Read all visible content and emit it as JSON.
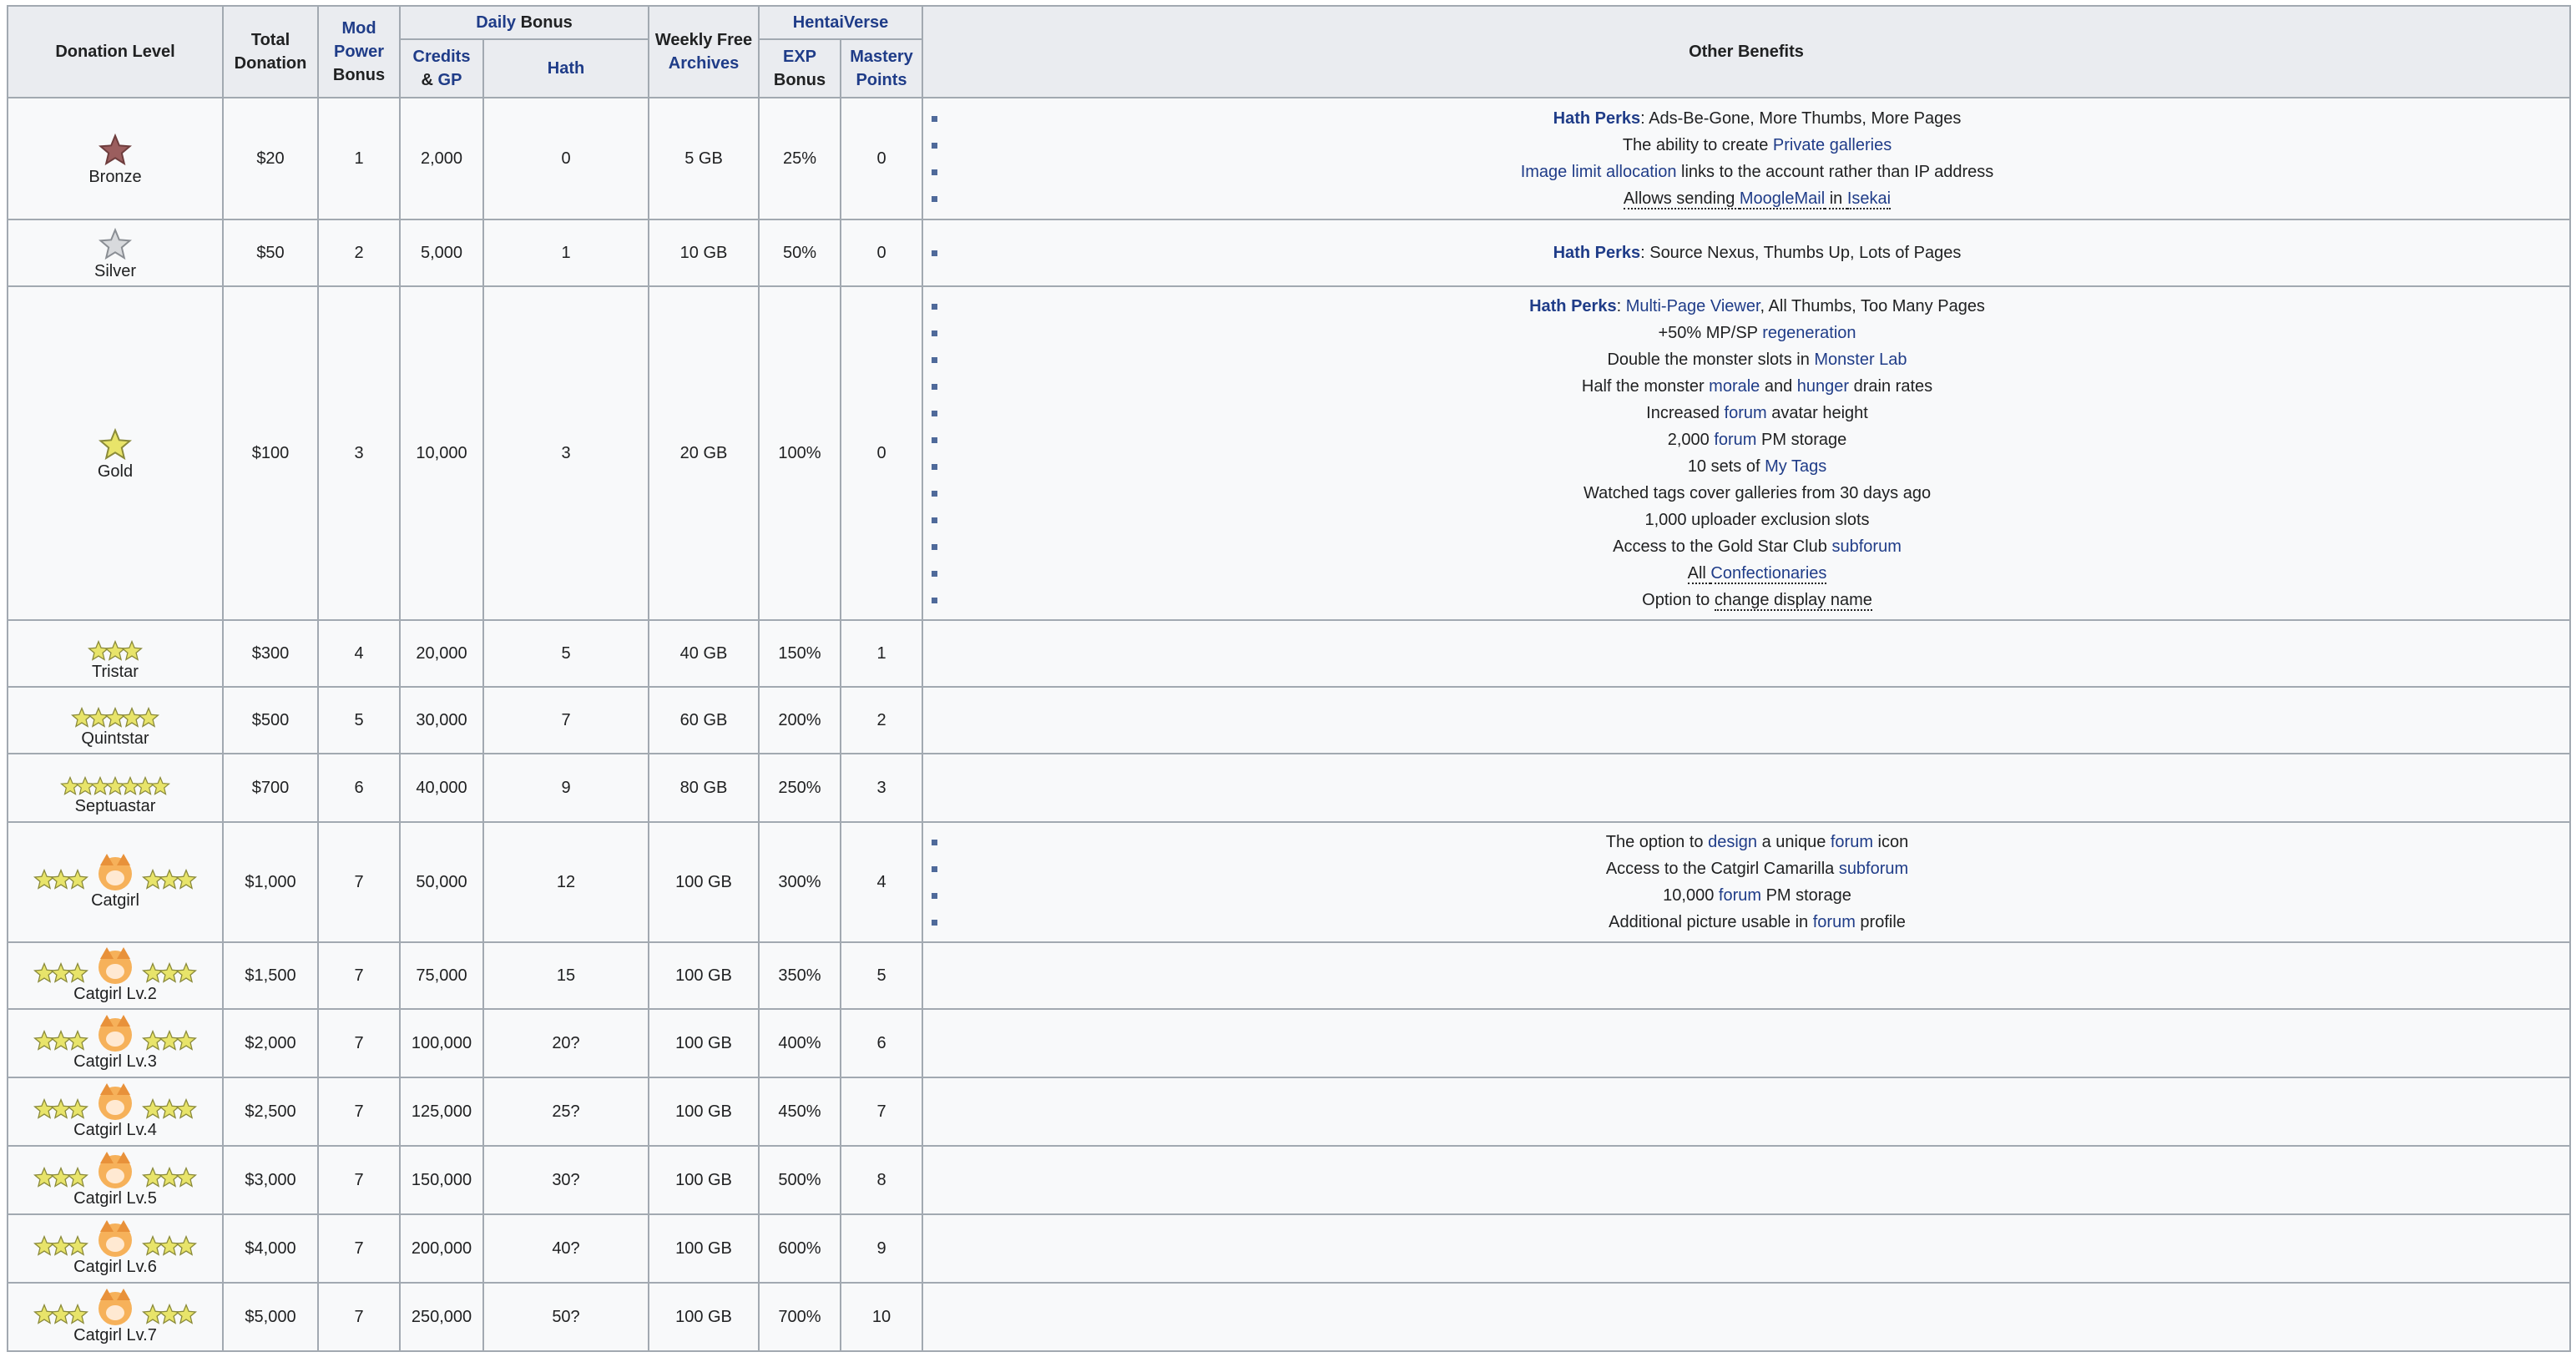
{
  "headers": {
    "donation_level": "Donation Level",
    "total_donation": "Total Donation",
    "mod_power_link": "Mod Power",
    "mod_power_suffix": "Bonus",
    "daily_bonus_link": "Daily",
    "daily_bonus_suffix": "Bonus",
    "weekly_free": "Weekly Free",
    "weekly_archives_link": "Archives",
    "hentaiverse": "HentaiVerse",
    "credits": "Credits",
    "gp_prefix": "&",
    "gp": "GP",
    "hath": "Hath",
    "exp_link": "EXP",
    "exp_suffix": "Bonus",
    "mastery_points": "Mastery Points",
    "other_benefits": "Other Benefits"
  },
  "colors": {
    "header_bg": "#eaecf0",
    "cell_bg": "#f8f9fa",
    "border": "#a2a9b1",
    "link": "#1f3c88",
    "bronze_star": "#9b5e5e",
    "silver_star": "#d8dadd",
    "gold_star": "#e8e46a"
  },
  "rows": [
    {
      "level": "Bronze",
      "icon": "bronze-star-icon",
      "total": "$20",
      "mod": "1",
      "credits": "2,000",
      "hath": "0",
      "archives": "5 GB",
      "exp": "25%",
      "mastery": "0",
      "benefits": [
        {
          "parts": [
            {
              "t": "Hath Perks",
              "link": true,
              "bold": true
            },
            {
              "t": ": Ads-Be-Gone, More Thumbs, More Pages"
            }
          ]
        },
        {
          "parts": [
            {
              "t": "The ability to create "
            },
            {
              "t": "Private galleries",
              "link": true
            }
          ]
        },
        {
          "parts": [
            {
              "t": "Image limit allocation",
              "link": true
            },
            {
              "t": " links to the account rather than IP address"
            }
          ]
        },
        {
          "parts": [
            {
              "t": "Allows sending ",
              "dotted": true
            },
            {
              "t": "MoogleMail",
              "link": true,
              "dotted": true
            },
            {
              "t": " in ",
              "dotted": true
            },
            {
              "t": "Isekai",
              "link": true,
              "dotted": true
            }
          ]
        }
      ]
    },
    {
      "level": "Silver",
      "icon": "silver-star-icon",
      "total": "$50",
      "mod": "2",
      "credits": "5,000",
      "hath": "1",
      "archives": "10 GB",
      "exp": "50%",
      "mastery": "0",
      "benefits": [
        {
          "parts": [
            {
              "t": "Hath Perks",
              "link": true,
              "bold": true
            },
            {
              "t": ": Source Nexus, Thumbs Up, Lots of Pages"
            }
          ]
        }
      ]
    },
    {
      "level": "Gold",
      "icon": "gold-star-icon",
      "total": "$100",
      "mod": "3",
      "credits": "10,000",
      "hath": "3",
      "archives": "20 GB",
      "exp": "100%",
      "mastery": "0",
      "benefits": [
        {
          "parts": [
            {
              "t": "Hath Perks",
              "link": true,
              "bold": true
            },
            {
              "t": ": "
            },
            {
              "t": "Multi-Page Viewer",
              "link": true
            },
            {
              "t": ", All Thumbs, Too Many Pages"
            }
          ]
        },
        {
          "parts": [
            {
              "t": "+50% MP/SP "
            },
            {
              "t": "regeneration",
              "link": true
            }
          ]
        },
        {
          "parts": [
            {
              "t": "Double the monster slots in "
            },
            {
              "t": "Monster Lab",
              "link": true
            }
          ]
        },
        {
          "parts": [
            {
              "t": "Half the monster "
            },
            {
              "t": "morale",
              "link": true
            },
            {
              "t": " and "
            },
            {
              "t": "hunger",
              "link": true
            },
            {
              "t": " drain rates"
            }
          ]
        },
        {
          "parts": [
            {
              "t": "Increased "
            },
            {
              "t": "forum",
              "link": true
            },
            {
              "t": " avatar height"
            }
          ]
        },
        {
          "parts": [
            {
              "t": "2,000 "
            },
            {
              "t": "forum",
              "link": true
            },
            {
              "t": " PM storage"
            }
          ]
        },
        {
          "parts": [
            {
              "t": "10 sets of "
            },
            {
              "t": "My Tags",
              "link": true
            }
          ]
        },
        {
          "parts": [
            {
              "t": "Watched tags cover galleries from 30 days ago"
            }
          ]
        },
        {
          "parts": [
            {
              "t": "1,000 uploader exclusion slots"
            }
          ]
        },
        {
          "parts": [
            {
              "t": "Access to the Gold Star Club "
            },
            {
              "t": "subforum",
              "link": true
            }
          ]
        },
        {
          "parts": [
            {
              "t": "All ",
              "dotted": true
            },
            {
              "t": "Confectionaries",
              "link": true,
              "dotted": true
            }
          ]
        },
        {
          "parts": [
            {
              "t": "Option to "
            },
            {
              "t": "change display name",
              "dotted": true
            }
          ]
        }
      ]
    },
    {
      "level": "Tristar",
      "icon": "tristar-icon",
      "total": "$300",
      "mod": "4",
      "credits": "20,000",
      "hath": "5",
      "archives": "40 GB",
      "exp": "150%",
      "mastery": "1",
      "benefits": []
    },
    {
      "level": "Quintstar",
      "icon": "quintstar-icon",
      "total": "$500",
      "mod": "5",
      "credits": "30,000",
      "hath": "7",
      "archives": "60 GB",
      "exp": "200%",
      "mastery": "2",
      "benefits": []
    },
    {
      "level": "Septuastar",
      "icon": "septuastar-icon",
      "total": "$700",
      "mod": "6",
      "credits": "40,000",
      "hath": "9",
      "archives": "80 GB",
      "exp": "250%",
      "mastery": "3",
      "benefits": []
    },
    {
      "level": "Catgirl",
      "icon": "catgirl-icon",
      "total": "$1,000",
      "mod": "7",
      "credits": "50,000",
      "hath": "12",
      "archives": "100 GB",
      "exp": "300%",
      "mastery": "4",
      "benefits": [
        {
          "parts": [
            {
              "t": "The option to "
            },
            {
              "t": "design",
              "link": true
            },
            {
              "t": " a unique "
            },
            {
              "t": "forum",
              "link": true
            },
            {
              "t": " icon"
            }
          ]
        },
        {
          "parts": [
            {
              "t": "Access to the Catgirl Camarilla "
            },
            {
              "t": "subforum",
              "link": true
            }
          ]
        },
        {
          "parts": [
            {
              "t": "10,000 "
            },
            {
              "t": "forum",
              "link": true
            },
            {
              "t": " PM storage"
            }
          ]
        },
        {
          "parts": [
            {
              "t": "Additional picture usable in "
            },
            {
              "t": "forum",
              "link": true
            },
            {
              "t": " profile"
            }
          ]
        }
      ]
    },
    {
      "level": "Catgirl Lv.2",
      "icon": "catgirl-icon",
      "total": "$1,500",
      "mod": "7",
      "credits": "75,000",
      "hath": "15",
      "archives": "100 GB",
      "exp": "350%",
      "mastery": "5",
      "benefits": []
    },
    {
      "level": "Catgirl Lv.3",
      "icon": "catgirl-icon",
      "total": "$2,000",
      "mod": "7",
      "credits": "100,000",
      "hath": "20?",
      "archives": "100 GB",
      "exp": "400%",
      "mastery": "6",
      "benefits": []
    },
    {
      "level": "Catgirl Lv.4",
      "icon": "catgirl-icon",
      "total": "$2,500",
      "mod": "7",
      "credits": "125,000",
      "hath": "25?",
      "archives": "100 GB",
      "exp": "450%",
      "mastery": "7",
      "benefits": []
    },
    {
      "level": "Catgirl Lv.5",
      "icon": "catgirl-icon",
      "total": "$3,000",
      "mod": "7",
      "credits": "150,000",
      "hath": "30?",
      "archives": "100 GB",
      "exp": "500%",
      "mastery": "8",
      "benefits": []
    },
    {
      "level": "Catgirl Lv.6",
      "icon": "catgirl-icon",
      "total": "$4,000",
      "mod": "7",
      "credits": "200,000",
      "hath": "40?",
      "archives": "100 GB",
      "exp": "600%",
      "mastery": "9",
      "benefits": []
    },
    {
      "level": "Catgirl Lv.7",
      "icon": "catgirl-icon",
      "total": "$5,000",
      "mod": "7",
      "credits": "250,000",
      "hath": "50?",
      "archives": "100 GB",
      "exp": "700%",
      "mastery": "10",
      "benefits": []
    }
  ]
}
